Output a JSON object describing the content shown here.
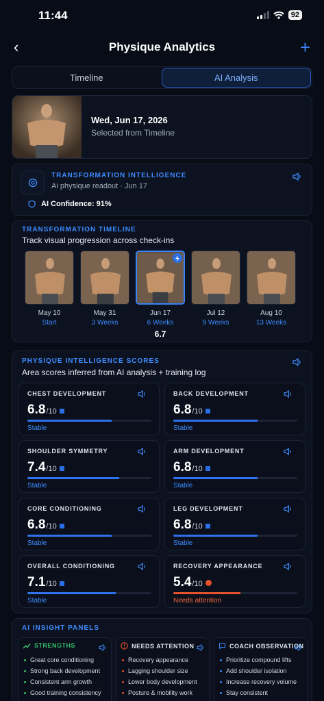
{
  "status_bar": {
    "time": "11:44",
    "battery": "92"
  },
  "nav": {
    "title": "Physique Analytics"
  },
  "tabs": [
    {
      "label": "Timeline"
    },
    {
      "label": "AI Analysis"
    }
  ],
  "selected": {
    "date": "Wed, Jun 17, 2026",
    "source": "Selected from Timeline"
  },
  "transformation": {
    "title": "TRANSFORMATION INTELLIGENCE",
    "subtitle": "Ai physique readout · Jun 17",
    "confidence": "AI Confidence: 91%"
  },
  "timeline": {
    "title": "TRANSFORMATION TIMELINE",
    "subtitle": "Track visual progression across check-ins",
    "items": [
      {
        "date": "May 10",
        "label": "Start"
      },
      {
        "date": "May 31",
        "label": "3 Weeks"
      },
      {
        "date": "Jun 17",
        "label": "6 Weeks",
        "score": "6.7"
      },
      {
        "date": "Jul 12",
        "label": "9 Weeks"
      },
      {
        "date": "Aug 10",
        "label": "13 Weeks"
      }
    ]
  },
  "scores": {
    "title": "PHYSIQUE INTELLIGENCE SCORES",
    "subtitle": "Area scores inferred from AI analysis + training log",
    "denominator": "/10",
    "items": [
      {
        "label": "CHEST DEVELOPMENT",
        "value": "6.8",
        "status": "Stable",
        "level": 0.68
      },
      {
        "label": "BACK DEVELOPMENT",
        "value": "6.8",
        "status": "Stable",
        "level": 0.68
      },
      {
        "label": "SHOULDER SYMMETRY",
        "value": "7.4",
        "status": "Stable",
        "level": 0.74
      },
      {
        "label": "ARM DEVELOPMENT",
        "value": "6.8",
        "status": "Stable",
        "level": 0.68
      },
      {
        "label": "CORE CONDITIONING",
        "value": "6.8",
        "status": "Stable",
        "level": 0.68
      },
      {
        "label": "LEG DEVELOPMENT",
        "value": "6.8",
        "status": "Stable",
        "level": 0.68
      },
      {
        "label": "OVERALL CONDITIONING",
        "value": "7.1",
        "status": "Stable",
        "level": 0.71
      },
      {
        "label": "RECOVERY APPEARANCE",
        "value": "5.4",
        "status": "Needs attention",
        "level": 0.54
      }
    ]
  },
  "insights": {
    "title": "AI INSIGHT PANELS",
    "panels": [
      {
        "title": "STRENGTHS",
        "color": "#37c06b",
        "items": [
          "Great core conditioning",
          "Strong back development",
          "Consistent arm growth",
          "Good training consistency"
        ]
      },
      {
        "title": "NEEDS ATTENTION",
        "color": "#e2522d",
        "items": [
          "Recovery appearance",
          "Lagging shoulder size",
          "Lower body development",
          "Posture & mobility work"
        ]
      },
      {
        "title": "COACH OBSERVATION",
        "color": "#3f8cff",
        "items": [
          "Prioritize compound lifts",
          "Add shoulder isolation",
          "Increase recovery volume",
          "Stay consistent"
        ]
      }
    ]
  }
}
